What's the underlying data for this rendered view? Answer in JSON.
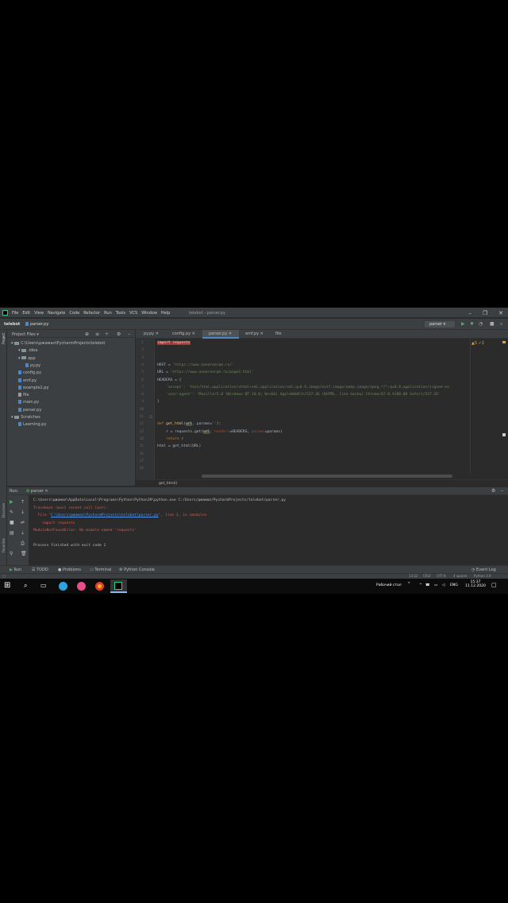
{
  "menubar": {
    "items": [
      "File",
      "Edit",
      "View",
      "Navigate",
      "Code",
      "Refactor",
      "Run",
      "Tools",
      "VCS",
      "Window",
      "Help"
    ],
    "title": "telebot - parser.py"
  },
  "navbar": {
    "project": "telebot",
    "file": "parser.py",
    "run_config": "parser"
  },
  "project_panel": {
    "title": "Project Files",
    "tree": [
      {
        "label": "C:\\Users\\джамал\\PycharmProjects\\telebot",
        "type": "folder",
        "level": 0
      },
      {
        "label": ".idea",
        "type": "folder",
        "level": 1
      },
      {
        "label": "app",
        "type": "folder",
        "level": 1
      },
      {
        "label": "py.py",
        "type": "py",
        "level": 2
      },
      {
        "label": "config.py",
        "type": "py",
        "level": 1
      },
      {
        "label": "emf.py",
        "type": "py",
        "level": 1
      },
      {
        "label": "example1.py",
        "type": "py",
        "level": 1
      },
      {
        "label": "file",
        "type": "file",
        "level": 1
      },
      {
        "label": "main.py",
        "type": "py",
        "level": 1
      },
      {
        "label": "parser.py",
        "type": "py",
        "level": 1
      },
      {
        "label": "Scratches",
        "type": "folder",
        "level": 0
      },
      {
        "label": "Learning.py",
        "type": "py",
        "level": 1
      }
    ]
  },
  "editor": {
    "tabs": [
      "py.py",
      "config.py",
      "parser.py",
      "emf.py",
      "file"
    ],
    "active_tab": "parser.py",
    "inspections": "▲5 ✓2",
    "line_numbers": [
      "1",
      "2",
      "3",
      "4",
      "5",
      "6",
      "7",
      "8",
      "9",
      "10",
      "11",
      "12",
      "13",
      "14",
      "15",
      "16",
      "17",
      "18"
    ],
    "code": {
      "l1_kw": "import",
      "l1_mod": " requests",
      "l4": "HOST = ",
      "l4_str": "'https://www.ooeoroorpm.ru/'",
      "l5": "URL = ",
      "l5_str": "'https://www.ooeoroorpm.ru/page2.html'",
      "l6": "HEADERS = {",
      "l7_str": "    'accept': 'text/html,application/xhtml+xml,application/xml;q=0.9,image/avif,image/webp,image/apng,*/*;q=0.8,application/signed-ex",
      "l8_str": "    'user-agent': 'Mozilla/5.0 (Windows NT 10.0; Win64) AppleWebKit/537.36 (KHTML, like Gecko) Chrome/87.0.4280.88 Safari/537.36'",
      "l9": "}",
      "l12_kw": "def ",
      "l12_fn": "get_html",
      "l12_a": "(",
      "l12_p1": "url",
      "l12_b": ", ",
      "l12_p2": "params",
      "l12_c": "=",
      "l12_str": "''",
      "l12_d": "):",
      "l13_a": "    r = requests.get(",
      "l13_b": "url",
      "l13_c": ", ",
      "l13_d": "headers",
      "l13_e": "=HEADERS, ",
      "l13_f": "params",
      "l13_g": "=params)",
      "l14_kw": "    return ",
      "l14_b": "r",
      "l15": "html = get_html(URL)"
    },
    "footer_fn": "get_html()"
  },
  "run_panel": {
    "label": "Run:",
    "config": "parser",
    "output": [
      {
        "text": "C:\\Users\\джамал\\AppData\\Local\\Programs\\Python\\Python39\\python.exe C:/Users/джамал/PycharmProjects/telebot/parser.py",
        "kind": "normal"
      },
      {
        "text": "Traceback (most recent call last):",
        "kind": "error"
      },
      {
        "text": "  File \"",
        "kind": "error"
      },
      {
        "text": "    import requests",
        "kind": "error"
      },
      {
        "text": "ModuleNotFoundError: No module named 'requests'",
        "kind": "error"
      },
      {
        "text": "",
        "kind": "normal"
      },
      {
        "text": "Process finished with exit code 1",
        "kind": "normal"
      }
    ],
    "file_link": "C:\\Users\\джамал\\PycharmProjects\\telebot\\parser.py",
    "file_line_suffix": "\", line 1, in <module>"
  },
  "tool_tabs": [
    "Run",
    "TODO",
    "Problems",
    "Terminal",
    "Python Console"
  ],
  "event_log": "Event Log",
  "status_bar": {
    "position": "13:22",
    "line_sep": "CRLF",
    "encoding": "UTF-8",
    "indent": "4 spaces",
    "interpreter": "Python 3.9"
  },
  "taskbar": {
    "desktop_label": "Рабочий стол",
    "language": "ENG",
    "time": "15:37",
    "date": "11.12.2020"
  },
  "colors": {
    "background": "#2b2b2b",
    "panel": "#3c3f41",
    "keyword": "#cc7832",
    "string": "#6a8759",
    "error": "#cf5b56",
    "accent": "#4a88c7"
  }
}
